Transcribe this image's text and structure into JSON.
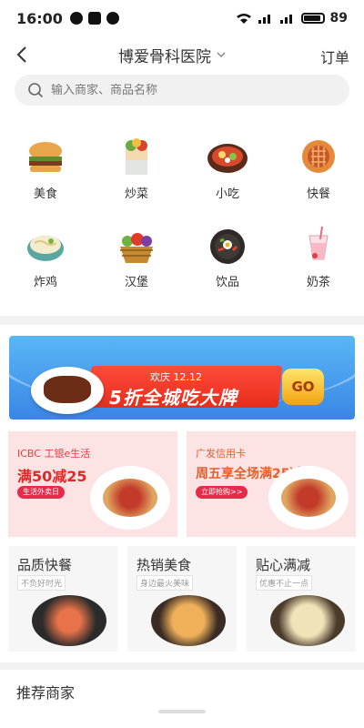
{
  "status_bar": {
    "time": "16:00",
    "battery": "89"
  },
  "header": {
    "title": "博爱骨科医院",
    "orders": "订单"
  },
  "search": {
    "placeholder": "输入商家、商品名称"
  },
  "categories": [
    {
      "label": "美食",
      "icon": "burger-icon"
    },
    {
      "label": "炒菜",
      "icon": "wrap-icon"
    },
    {
      "label": "小吃",
      "icon": "hotpot-icon"
    },
    {
      "label": "快餐",
      "icon": "waffle-icon"
    },
    {
      "label": "炸鸡",
      "icon": "noodle-bowl-icon"
    },
    {
      "label": "汉堡",
      "icon": "fruit-basket-icon"
    },
    {
      "label": "饮品",
      "icon": "bibimbap-icon"
    },
    {
      "label": "奶茶",
      "icon": "milk-tea-icon"
    }
  ],
  "banner": {
    "subtitle": "欢庆 12.12",
    "headline": "5折全城吃大牌",
    "go": "GO"
  },
  "promos": [
    {
      "tag": "ICBC 工银e生活",
      "offer": "满50减25",
      "button": "生活外卖日"
    },
    {
      "tag": "广发信用卡",
      "offer": "周五享全场满25减50",
      "button": "立即抢购>>"
    }
  ],
  "features": [
    {
      "title": "品质快餐",
      "subtitle": "不负好时光"
    },
    {
      "title": "热销美食",
      "subtitle": "身边最火美味"
    },
    {
      "title": "贴心满减",
      "subtitle": "优惠不止一点"
    }
  ],
  "recommend": "推荐商家",
  "colors": {
    "accent": "#e02828",
    "promo_bg": "#fde3e3",
    "banner_blue": "#3a86e6"
  }
}
